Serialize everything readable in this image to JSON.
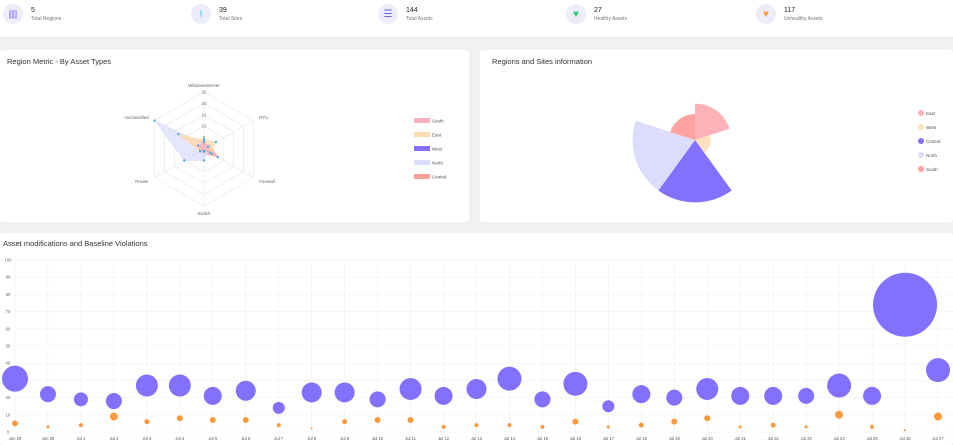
{
  "stats": [
    {
      "value": "5",
      "label": "Total Regions",
      "icon": "map-icon",
      "color": "#8470ff"
    },
    {
      "value": "39",
      "label": "Total Sites",
      "icon": "pin-icon",
      "color": "#1ec8e6"
    },
    {
      "value": "144",
      "label": "Total Assets",
      "icon": "server-icon",
      "color": "#6c5ce7"
    },
    {
      "value": "27",
      "label": "Healthy Assets",
      "icon": "heart-icon",
      "color": "#2ecc71"
    },
    {
      "value": "117",
      "label": "Unhealthy Assets",
      "icon": "heart-icon",
      "color": "#ff9a3c"
    }
  ],
  "radar_card": {
    "title": "Region Metric - By Asset Types"
  },
  "polar_card": {
    "title": "Regions and Sites information"
  },
  "bubble_card": {
    "title": "Asset modifications and Baseline Violations"
  },
  "chart_data": [
    {
      "type": "radar",
      "axes": [
        "WindowsServer",
        "RTU",
        "Firewall",
        "Switch",
        "Router",
        "Unclassified"
      ],
      "rlim": [
        0,
        25
      ],
      "ticks": [
        5,
        10,
        15,
        20,
        25
      ],
      "legend_position": "right",
      "series": [
        {
          "name": "South",
          "color": "#ffb1c1",
          "values": [
            3,
            2,
            3,
            1,
            2,
            3
          ]
        },
        {
          "name": "East",
          "color": "#ffdcb0",
          "values": [
            4,
            6,
            4,
            1,
            2,
            13
          ]
        },
        {
          "name": "West",
          "color": "#8470ff",
          "values": [
            1,
            1,
            1,
            1,
            1,
            1
          ]
        },
        {
          "name": "North",
          "color": "#dcdcfc",
          "values": [
            2,
            2,
            2,
            5,
            10,
            25
          ]
        },
        {
          "name": "Central",
          "color": "#ff9f9a",
          "values": [
            3,
            3,
            7,
            2,
            2,
            12
          ]
        }
      ]
    },
    {
      "type": "polarArea",
      "legend_position": "right",
      "categories": [
        "East",
        "West",
        "Central",
        "North",
        "South"
      ],
      "colors": [
        "#ffb1b8",
        "#ffe0bd",
        "#8470ff",
        "#dcdcfc",
        "#ffa3a0"
      ],
      "values": [
        7,
        3,
        12,
        12,
        5
      ]
    },
    {
      "type": "bubble",
      "ylim": [
        0,
        100
      ],
      "yticks": [
        0,
        10,
        20,
        30,
        40,
        50,
        60,
        70,
        80,
        90,
        100
      ],
      "grid": true,
      "x": [
        "Jun 29",
        "Jun 30",
        "Jul 1",
        "Jul 2",
        "Jul 3",
        "Jul 4",
        "Jul 5",
        "Jul 6",
        "Jul 7",
        "Jul 8",
        "Jul 9",
        "Jul 10",
        "Jul 11",
        "Jul 12",
        "Jul 13",
        "Jul 14",
        "Jul 15",
        "Jul 16",
        "Jul 17",
        "Jul 18",
        "Jul 19",
        "Jul 20",
        "Jul 21",
        "Jul 22",
        "Jul 23",
        "Jul 24",
        "Jul 25",
        "Jul 26",
        "Jul 27"
      ],
      "series": [
        {
          "color": "#8470ff",
          "y": [
            31,
            22,
            19,
            18,
            27,
            27,
            21,
            24,
            14,
            23,
            23,
            19,
            25,
            21,
            25,
            31,
            19,
            28,
            15,
            22,
            20,
            25,
            21,
            21,
            21,
            27,
            21,
            74,
            36
          ],
          "r": [
            13,
            8,
            7,
            8,
            11,
            11,
            9,
            10,
            6,
            10,
            10,
            8,
            11,
            9,
            10,
            12,
            8,
            12,
            6,
            9,
            8,
            11,
            9,
            9,
            8,
            12,
            9,
            32,
            12
          ]
        },
        {
          "color": "#ff9a3c",
          "y": [
            5,
            3,
            4,
            9,
            6,
            8,
            7,
            7,
            4,
            2,
            6,
            7,
            7,
            3,
            4,
            4,
            3,
            6,
            3,
            4,
            6,
            8,
            3,
            4,
            3,
            10,
            3,
            1,
            9
          ],
          "r": [
            3,
            1.5,
            2,
            4,
            2.5,
            3,
            3,
            3,
            2,
            1,
            2.5,
            3,
            3,
            2,
            2,
            2,
            2,
            3,
            1.5,
            2.5,
            3,
            3,
            1.5,
            2.5,
            1.5,
            4,
            2,
            1,
            4
          ]
        }
      ]
    }
  ]
}
